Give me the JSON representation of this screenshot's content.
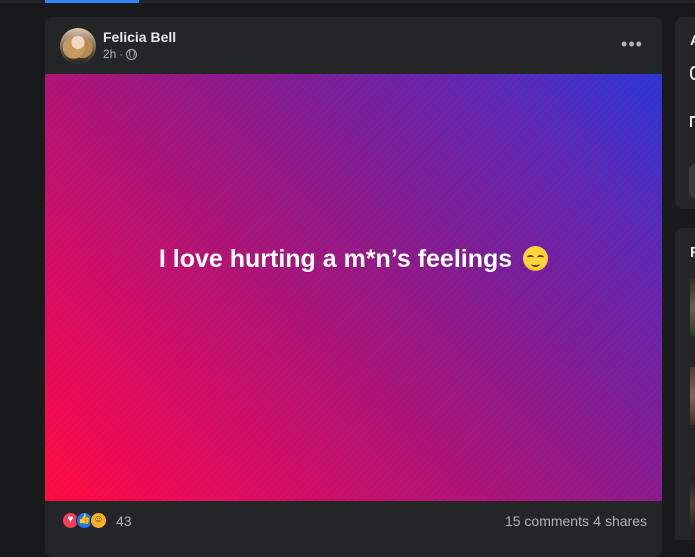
{
  "post": {
    "author_name": "Felicia Bell",
    "time": "2h",
    "separator": "·",
    "more_icon": "more-horizontal-icon",
    "text": "I love hurting a m*n’s feelings",
    "emoji": "relieved-face-emoji",
    "reactions": {
      "count": "43",
      "types": [
        "heart",
        "like",
        "haha"
      ]
    },
    "comments": "15 comments",
    "shares": "4 shares"
  },
  "sidebar": {
    "top_letter": "A",
    "bottom_letter": "F"
  },
  "colors": {
    "background": "#18191a",
    "card": "#242526",
    "text_primary": "#e4e6eb",
    "text_secondary": "#b0b3b8",
    "accent": "#2d88ff",
    "gradient_start": "#ff0a40",
    "gradient_end": "#2b35d6"
  }
}
